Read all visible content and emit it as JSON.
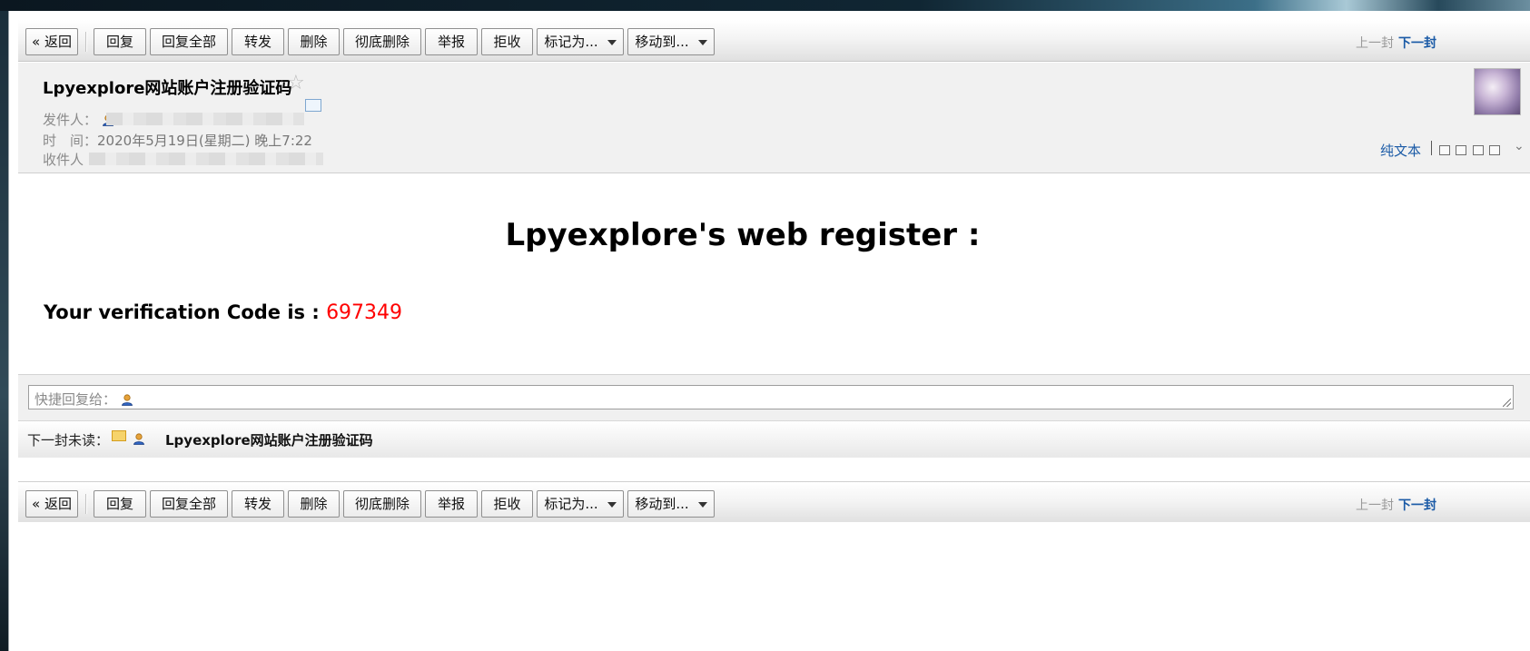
{
  "toolbar": {
    "back": "« 返回",
    "reply": "回复",
    "reply_all": "回复全部",
    "forward": "转发",
    "delete": "删除",
    "delete_forever": "彻底删除",
    "report": "举报",
    "reject": "拒收",
    "mark_as": "标记为...",
    "move_to": "移动到...",
    "prev": "上一封",
    "next": "下一封"
  },
  "header": {
    "subject": "Lpyexplore网站账户注册验证码",
    "star": "☆",
    "from_label": "发件人：",
    "time_label": "时　间：",
    "time_value": "2020年5月19日(星期二) 晚上7:22",
    "to_label": "收件人",
    "plain_text": "纯文本",
    "expand_icon": "chevron-double-down-icon"
  },
  "body": {
    "heading": "Lpyexplore's web register :",
    "code_prefix": "Your verification Code is : ",
    "code": "697349",
    "code_color": "#ff0000"
  },
  "quick_reply": {
    "label": "快捷回复给："
  },
  "next_unread": {
    "label": "下一封未读：",
    "subject": "Lpyexplore网站账户注册验证码"
  },
  "colors": {
    "link": "#1a5aa6",
    "muted": "#8a8a8a"
  }
}
